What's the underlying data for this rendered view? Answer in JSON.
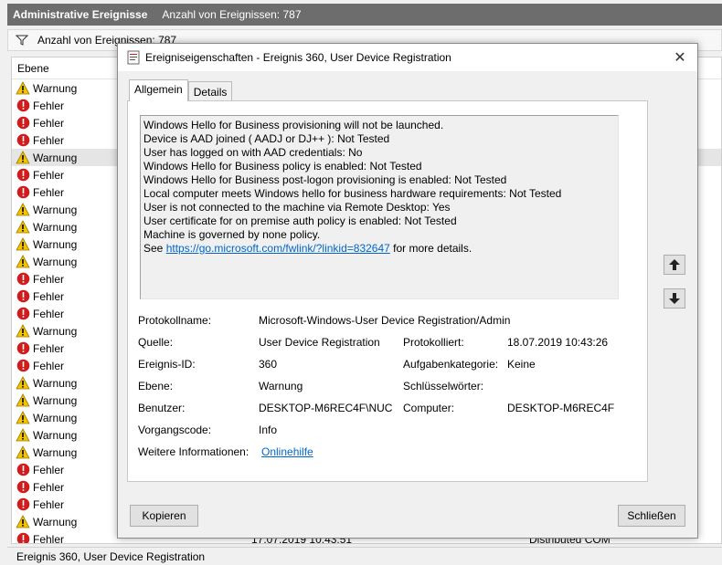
{
  "background": {
    "header_title": "Administrative Ereignisse",
    "header_count": "Anzahl von Ereignissen: 787",
    "filter_text": "Anzahl von Ereignissen: 787",
    "column_level": "Ebene",
    "rows": [
      "Warnung",
      "Fehler",
      "Fehler",
      "Fehler",
      "Warnung",
      "Fehler",
      "Fehler",
      "Warnung",
      "Warnung",
      "Warnung",
      "Warnung",
      "Fehler",
      "Fehler",
      "Fehler",
      "Warnung",
      "Fehler",
      "Fehler",
      "Warnung",
      "Warnung",
      "Warnung",
      "Warnung",
      "Warnung",
      "Fehler",
      "Fehler",
      "Fehler",
      "Warnung",
      "Fehler"
    ],
    "selected_row": 4,
    "partial_row": {
      "date": "17.07.2019 10:43:51",
      "source": "Distributed COM"
    },
    "status": "Ereignis 360, User Device Registration"
  },
  "dialog": {
    "title": "Ereigniseigenschaften - Ereignis 360, User Device Registration",
    "close_glyph": "✕",
    "tabs": [
      "Allgemein",
      "Details"
    ],
    "description_lines": [
      "Windows Hello for Business provisioning will not be launched.",
      "Device is AAD joined ( AADJ or DJ++ ): Not Tested",
      "User has logged on with AAD credentials: No",
      "Windows Hello for Business policy is enabled: Not Tested",
      "Windows Hello for Business post-logon provisioning is enabled: Not Tested",
      "Local computer meets Windows hello for business hardware requirements: Not Tested",
      "User is not connected to the machine via Remote Desktop: Yes",
      "User certificate for on premise auth policy is enabled: Not Tested",
      "Machine is governed by none policy."
    ],
    "see_prefix": "See ",
    "see_link": "https://go.microsoft.com/fwlink/?linkid=832647",
    "see_suffix": " for more details.",
    "props": {
      "protokollname_label": "Protokollname:",
      "protokollname_value": "Microsoft-Windows-User Device Registration/Admin",
      "quelle_label": "Quelle:",
      "quelle_value": "User Device Registration",
      "protokolliert_label": "Protokolliert:",
      "protokolliert_value": "18.07.2019 10:43:26",
      "ereignis_id_label": "Ereignis-ID:",
      "ereignis_id_value": "360",
      "aufgabenkategorie_label": "Aufgabenkategorie:",
      "aufgabenkategorie_value": "Keine",
      "ebene_label": "Ebene:",
      "ebene_value": "Warnung",
      "schluesselwoerter_label": "Schlüsselwörter:",
      "benutzer_label": "Benutzer:",
      "benutzer_value": "DESKTOP-M6REC4F\\NUC",
      "computer_label": "Computer:",
      "computer_value": "DESKTOP-M6REC4F",
      "vorgangscode_label": "Vorgangscode:",
      "vorgangscode_value": "Info",
      "weitere_label": "Weitere Informationen:",
      "weitere_link": "Onlinehilfe"
    },
    "copy_button": "Kopieren",
    "close_button": "Schließen"
  },
  "colors": {
    "warning": "#f5c400",
    "error": "#d01c1c",
    "link": "#0066cc"
  }
}
